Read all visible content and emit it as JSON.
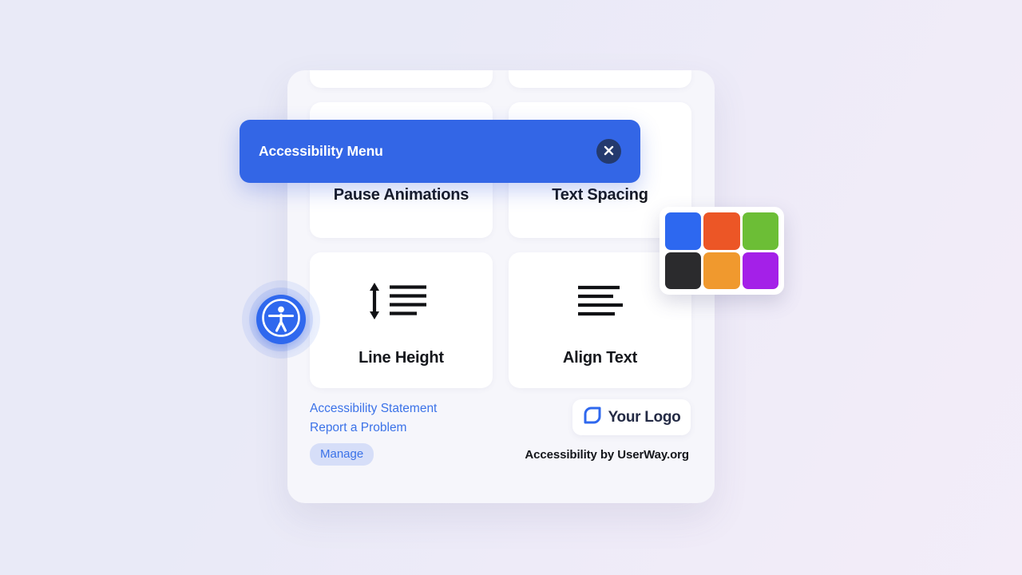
{
  "header": {
    "title": "Accessibility Menu",
    "close_label": "Close",
    "background_color": "#3366e6",
    "close_button_color": "#243a6e"
  },
  "launcher": {
    "name": "Accessibility launcher",
    "color": "#2f68ee"
  },
  "menu": {
    "partial_cards": [
      {
        "name": "partial-card-left"
      },
      {
        "name": "partial-card-right"
      }
    ],
    "cards": [
      {
        "label": "Pause Animations",
        "icon": "pause-animations-icon"
      },
      {
        "label": "Text Spacing",
        "icon": "text-spacing-icon"
      },
      {
        "label": "Line Height",
        "icon": "line-height-icon"
      },
      {
        "label": "Align Text",
        "icon": "align-text-icon"
      }
    ]
  },
  "footer": {
    "links": [
      {
        "label": "Accessibility Statement"
      },
      {
        "label": "Report a Problem"
      }
    ],
    "manage_label": "Manage",
    "logo_text": "Your Logo",
    "credit": "Accessibility by UserWay.org",
    "link_color": "#3b72e8",
    "chip_background": "#d6def8"
  },
  "color_palette": {
    "swatches": [
      {
        "name": "swatch-blue",
        "color": "#2d68f0"
      },
      {
        "name": "swatch-red",
        "color": "#ec5626"
      },
      {
        "name": "swatch-green",
        "color": "#6cbe36"
      },
      {
        "name": "swatch-black",
        "color": "#2b2b2d"
      },
      {
        "name": "swatch-orange",
        "color": "#f0992e"
      },
      {
        "name": "swatch-purple",
        "color": "#a420e8"
      }
    ]
  },
  "background": {
    "gradient_from": "#e9eaf7",
    "gradient_to": "#f3edf9"
  }
}
